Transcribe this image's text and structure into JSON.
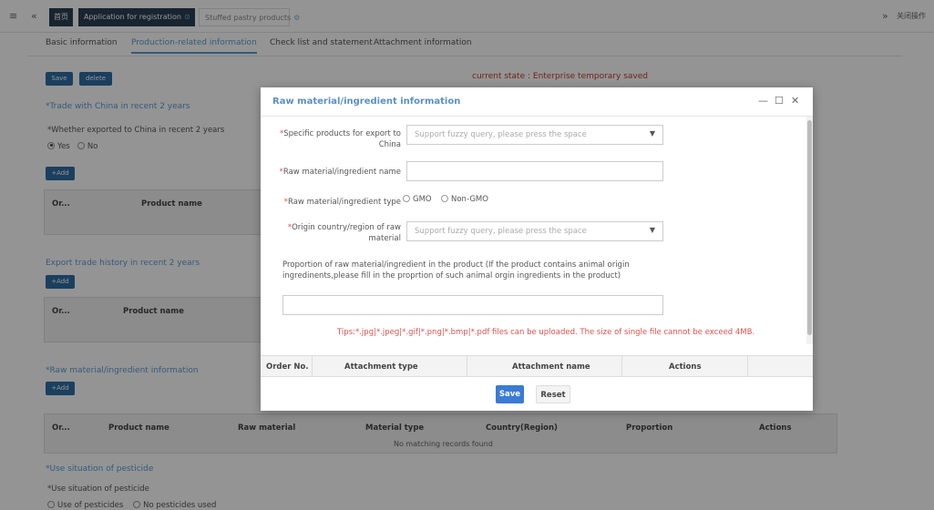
{
  "topbar": {
    "menu_icon": "≡",
    "back_icon": "«",
    "home_tab": "首页",
    "active_tab": "Application for registration",
    "second_tab": "Stuffed pastry products",
    "forward_icon": "»",
    "right_label": "关闭操作"
  },
  "subtabs": [
    "Basic information",
    "Production-related information",
    "Check list and statement",
    "Attachment information"
  ],
  "toolbar": {
    "save": "Save",
    "delete": "delete"
  },
  "state_text": "current state : Enterprise temporary saved",
  "trade": {
    "title": "*Trade with China in recent 2 years",
    "question": "*Whether exported to China in recent 2 years",
    "yes": "Yes",
    "no": "No",
    "add": "+Add",
    "headers": [
      "Or...",
      "Product name"
    ]
  },
  "history": {
    "title": "Export trade history in recent 2 years",
    "add": "+Add",
    "headers": [
      "Or...",
      "Product name"
    ]
  },
  "raw": {
    "title": "*Raw material/ingredient information",
    "add": "+Add",
    "headers": [
      "Or...",
      "Product name",
      "Raw material",
      "Material type",
      "Country(Region)",
      "Proportion",
      "Actions"
    ],
    "empty": "No matching records found"
  },
  "pesticide": {
    "title": "*Use situation of pesticide",
    "label": "*Use situation of pesticide",
    "opt1": "Use of pesticides",
    "opt2": "No pesticides used"
  },
  "modal": {
    "title": "Raw material/ingredient information",
    "controls": {
      "minimize": "—",
      "maximize": "☐",
      "close": "✕"
    },
    "f1_label": "Specific products for export to China",
    "f1_placeholder": "Support fuzzy query, please press the space",
    "f2_label": "Raw material/ingredient name",
    "f2_value": "",
    "f3_label": "Raw material/ingredient type",
    "f3_opt1": "GMO",
    "f3_opt2": "Non-GMO",
    "f4_label": "Origin country/region of raw material",
    "f4_placeholder": "Support fuzzy query, please press the space",
    "proportion_text": "Proportion of raw material/ingredient in the product  (If the product contains animal origin ingredinents,please fill in the proprtion of such animal orgin ingredients in the product)",
    "proportion_value": "",
    "tips": "Tips:*.jpg|*.jpeg|*.gif|*.png|*.bmp|*.pdf files can be uploaded. The size of single file cannot be exceed 4MB.",
    "table_headers": [
      "Order No.",
      "Attachment type",
      "Attachment name",
      "Actions"
    ],
    "save": "Save",
    "reset": "Reset"
  },
  "colors": {
    "nav_dark": "#2a3f54",
    "accent_blue": "#5b9bd5",
    "button_blue": "#3a7bd5",
    "alert_red": "#d9534f"
  }
}
